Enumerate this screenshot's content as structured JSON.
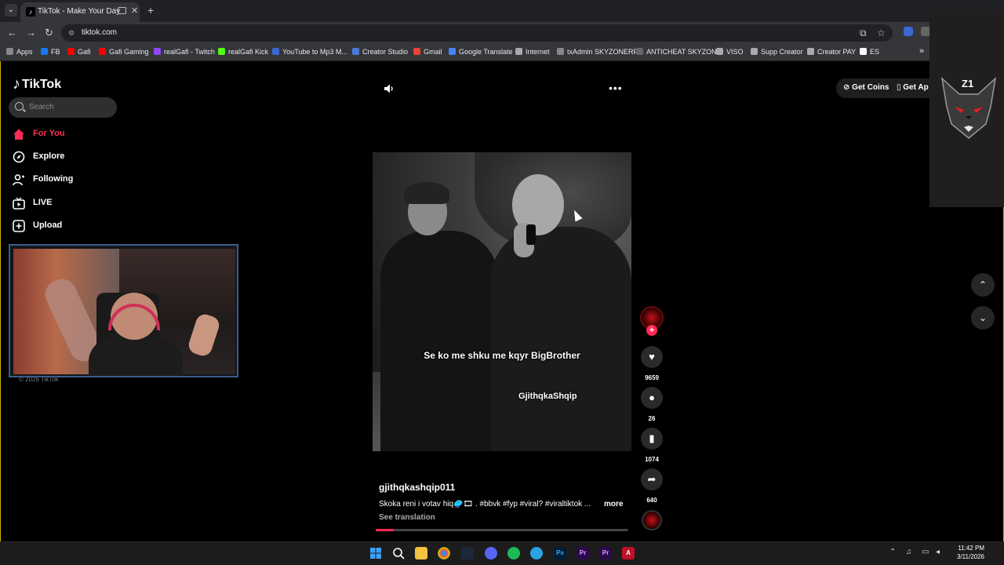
{
  "browser": {
    "tab_title": "TikTok - Make Your Day",
    "url": "tiktok.com",
    "new_tab": "+",
    "tab_close": "✕"
  },
  "bookmarks": [
    {
      "label": "Apps",
      "color": "#888888"
    },
    {
      "label": "FB",
      "color": "#1877f2"
    },
    {
      "label": "Gafi",
      "color": "#ff0000"
    },
    {
      "label": "Gafi Gaming",
      "color": "#ff0000"
    },
    {
      "label": "realGafi - Twitch",
      "color": "#9146ff"
    },
    {
      "label": "realGafi Kick",
      "color": "#53fc18"
    },
    {
      "label": "YouTube to Mp3 M...",
      "color": "#3a6ad0"
    },
    {
      "label": "Creator Studio",
      "color": "#4a7ad8"
    },
    {
      "label": "Gmail",
      "color": "#ea4335"
    },
    {
      "label": "Google Translate",
      "color": "#4285f4"
    },
    {
      "label": "Internet",
      "color": "#aaaaaa"
    },
    {
      "label": "txAdmin SKYZONERP",
      "color": "#888888"
    },
    {
      "label": "ANTICHEAT SKYZONE",
      "color": "#666666"
    },
    {
      "label": "VISO",
      "color": "#aaaaaa"
    },
    {
      "label": "Supp Creator",
      "color": "#aaaaaa"
    },
    {
      "label": "Creator PAY",
      "color": "#aaaaaa"
    },
    {
      "label": "ES",
      "color": "#ffffff"
    }
  ],
  "tiktok": {
    "logo_text": "TikTok",
    "search_placeholder": "Search",
    "nav": [
      {
        "label": "For You",
        "icon": "home-icon"
      },
      {
        "label": "Explore",
        "icon": "compass-icon"
      },
      {
        "label": "Following",
        "icon": "following-icon"
      },
      {
        "label": "LIVE",
        "icon": "live-icon"
      },
      {
        "label": "Upload",
        "icon": "upload-icon"
      }
    ],
    "copyright": "© 2026 TikTok",
    "get_coins": "Get Coins",
    "get_app": "Get Ap",
    "accent": "#fe2c55"
  },
  "video": {
    "caption": "Se ko me shku me kqyr BigBrother",
    "watermark": "GjithqkaShqip",
    "username": "gjithqkashqip011",
    "description": "Skoka reni i votav hiq🥏🎞 . #bbvk #fyp #viral? #viraltiktok ...",
    "more": "more",
    "see_translation": "See translation",
    "progress": 0.07
  },
  "actions": {
    "likes": "9659",
    "comments": "26",
    "saves": "1074",
    "shares": "640"
  },
  "overlay": {
    "brand_mark": "Z1"
  },
  "taskbar": {
    "time": "11:42 PM",
    "date": "3/11/2026"
  }
}
